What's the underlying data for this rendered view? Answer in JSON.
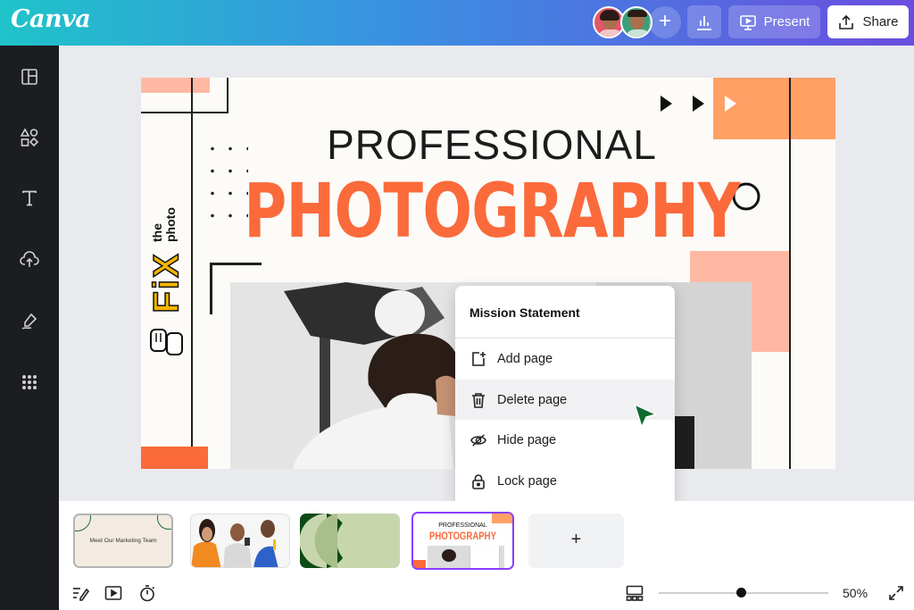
{
  "header": {
    "logo": "Canva",
    "present_label": "Present",
    "share_label": "Share",
    "add_collaborator": "+"
  },
  "sidebar": {
    "items": [
      "design-icon",
      "elements-icon",
      "text-icon",
      "uploads-icon",
      "draw-icon",
      "apps-icon"
    ]
  },
  "slide": {
    "title_line1": "PROFESSIONAL",
    "title_line2": "PHOTOGRAPHY",
    "logo_fix": "FiX",
    "logo_the": "the",
    "logo_photo": "photo"
  },
  "context_menu": {
    "title": "Mission Statement",
    "items": [
      {
        "label": "Add page",
        "icon": "add-page-icon"
      },
      {
        "label": "Delete page",
        "icon": "trash-icon"
      },
      {
        "label": "Hide page",
        "icon": "eye-off-icon"
      },
      {
        "label": "Lock page",
        "icon": "lock-icon"
      }
    ]
  },
  "filmstrip": {
    "thumb1_text": "Meet Our Marketing Team",
    "thumb4_line1": "PROFESSIONAL",
    "thumb4_line2": "PHOTOGRAPHY",
    "add_page": "+"
  },
  "footer": {
    "zoom": "50%",
    "zoom_fraction": 0.5
  },
  "colors": {
    "accent_orange": "#fb6a3b",
    "selection_purple": "#8b3dff",
    "sidebar_bg": "#1c1d21"
  }
}
